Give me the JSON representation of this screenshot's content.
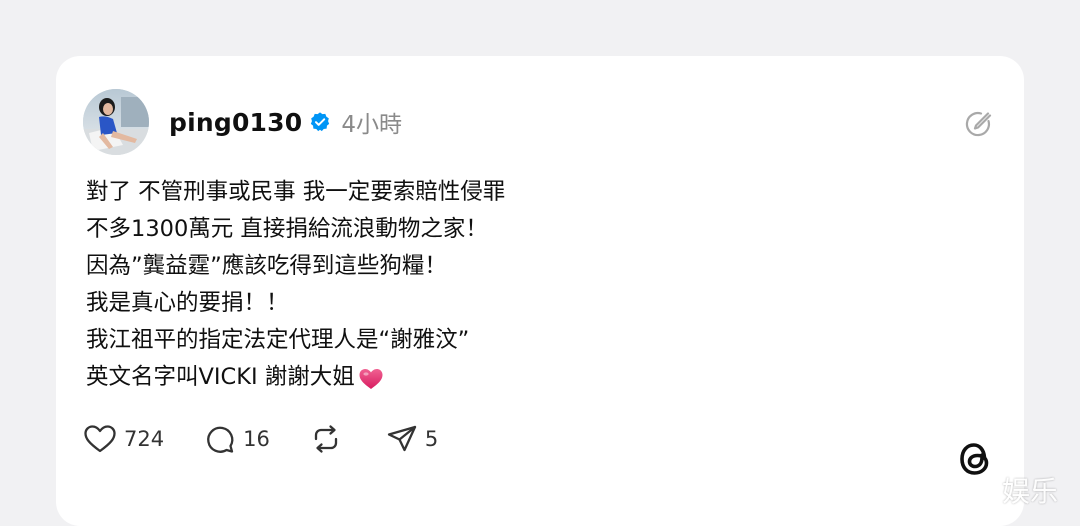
{
  "post": {
    "username": "ping0130",
    "timestamp": "4小時",
    "lines": [
      "對了 不管刑事或民事 我一定要索賠性侵罪",
      "不多1300萬元 直接捐給流浪動物之家！",
      "因為”龔益霆”應該吃得到這些狗糧！",
      "我是真心的要捐！！",
      "我江祖平的指定法定代理人是“謝雅汶”",
      "英文名字叫VICKI 謝謝大姐"
    ],
    "emoji": "heart-emoji"
  },
  "actions": {
    "likes": "724",
    "comments": "16",
    "shares": "5"
  },
  "icons": {
    "verified": "verified-badge-icon",
    "edit": "edit-icon",
    "like": "heart-icon",
    "comment": "comment-icon",
    "repost": "repost-icon",
    "share": "send-icon",
    "brand": "threads-logo-icon"
  },
  "colors": {
    "background": "#f1f1f3",
    "card": "#ffffff",
    "verified": "#0095f6",
    "heart": "#e0245e",
    "text": "#101010",
    "muted": "#8a8a8a"
  },
  "watermark": "娱乐"
}
